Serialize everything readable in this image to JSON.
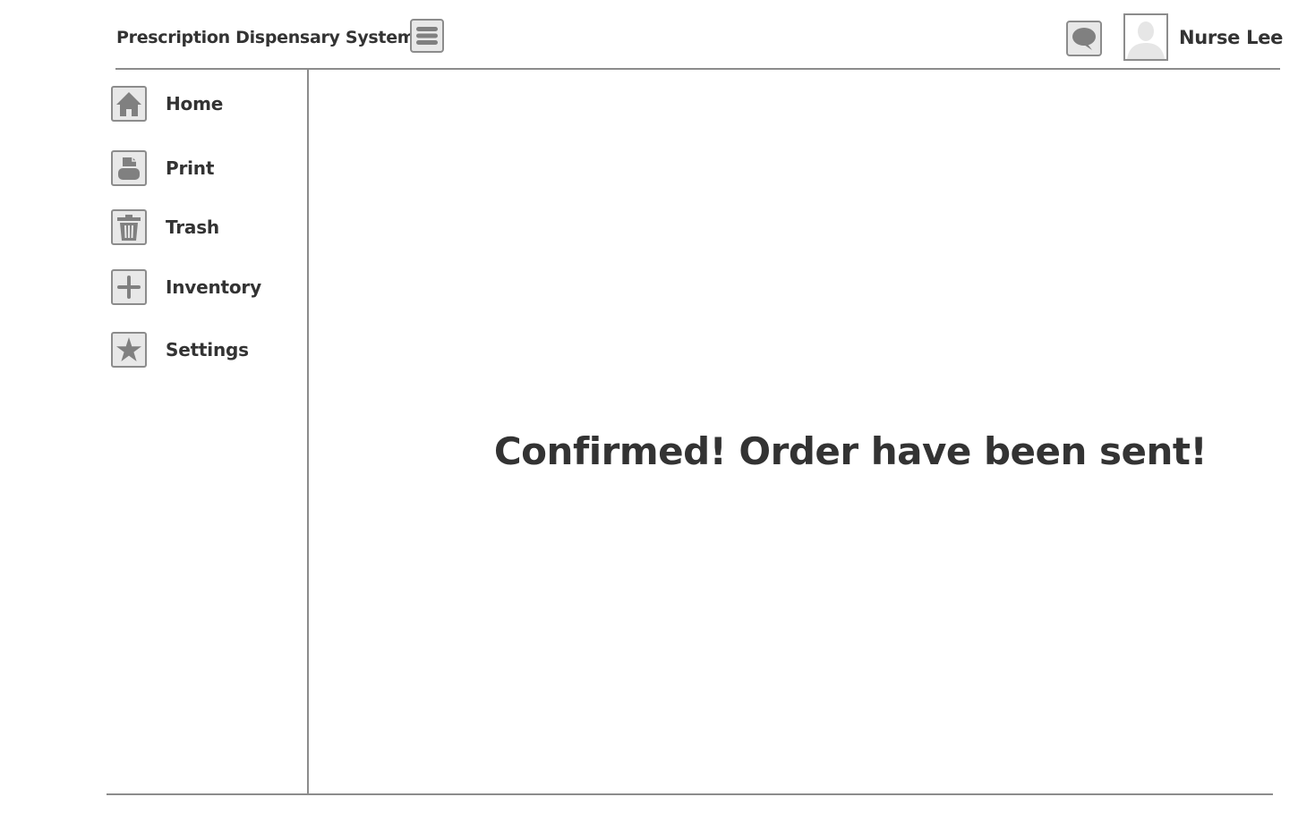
{
  "header": {
    "app_title": "Prescription Dispensary System",
    "menu_icon": "hamburger-menu-icon",
    "chat_icon": "speech-bubble-icon",
    "avatar_icon": "user-silhouette-icon",
    "user_name": "Nurse Lee"
  },
  "sidebar": {
    "items": [
      {
        "label": "Home",
        "icon": "home-icon"
      },
      {
        "label": "Print",
        "icon": "printer-icon"
      },
      {
        "label": "Trash",
        "icon": "trash-icon"
      },
      {
        "label": "Inventory",
        "icon": "plus-icon"
      },
      {
        "label": "Settings",
        "icon": "star-icon"
      }
    ]
  },
  "main": {
    "message": "Confirmed! Order have been sent!"
  },
  "colors": {
    "text": "#333333",
    "border": "#8c8c8c",
    "icon_fill": "#808080",
    "icon_background": "#e8e8e8",
    "background": "#ffffff"
  }
}
